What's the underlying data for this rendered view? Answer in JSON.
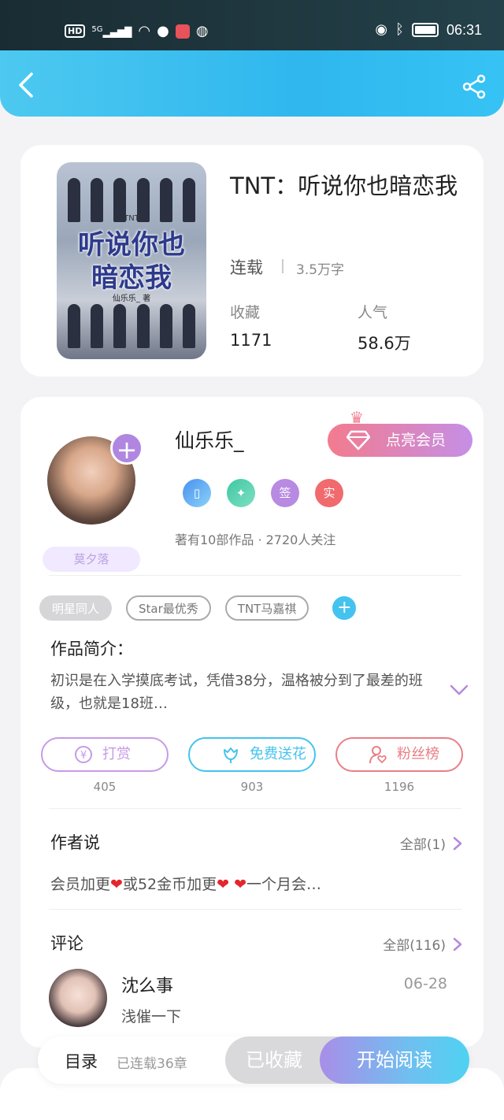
{
  "status_bar": {
    "hd": "HD",
    "network": "5G",
    "time": "06:31"
  },
  "book": {
    "title": "TNT：听说你也暗恋我",
    "status": "连载",
    "word_count": "3.5万字",
    "favorites_label": "收藏",
    "favorites_value": "1171",
    "popularity_label": "人气",
    "popularity_value": "58.6万",
    "cover": {
      "tag": "[TNT]",
      "title_line1": "听说你也",
      "title_line2": "暗恋我",
      "author": "仙乐乐_ 著"
    }
  },
  "author": {
    "name": "仙乐乐_",
    "vip_button": "点亮会员",
    "fan_tag": "莫夕落",
    "badges": [
      "",
      "",
      "签",
      "实"
    ],
    "meta": "著有10部作品 · 2720人关注"
  },
  "tags": [
    "明星同人",
    "Star最优秀",
    "TNT马嘉祺"
  ],
  "intro": {
    "title": "作品简介：",
    "text": "初识是在入学摸底考试，凭借38分，温格被分到了最差的班级，也就是18班…"
  },
  "actions": [
    {
      "label": "打赏",
      "count": "405",
      "color": "#c79ae6"
    },
    {
      "label": "免费送花",
      "count": "903",
      "color": "#44c3ee"
    },
    {
      "label": "粉丝榜",
      "count": "1196",
      "color": "#ea7e86"
    }
  ],
  "author_says": {
    "title": "作者说",
    "more": "全部(1)",
    "text_part1": "会员加更",
    "text_part2": "或52金币加更",
    "text_part3": "一个月会…",
    "heart": "❤"
  },
  "comments": {
    "title": "评论",
    "more": "全部(116)",
    "items": [
      {
        "name": "沈么事",
        "date": "06-28",
        "text": "浅催一下"
      }
    ]
  },
  "bottom_bar": {
    "toc": "目录",
    "toc_info": "已连载36章",
    "favorite": "已收藏",
    "read": "开始阅读"
  }
}
